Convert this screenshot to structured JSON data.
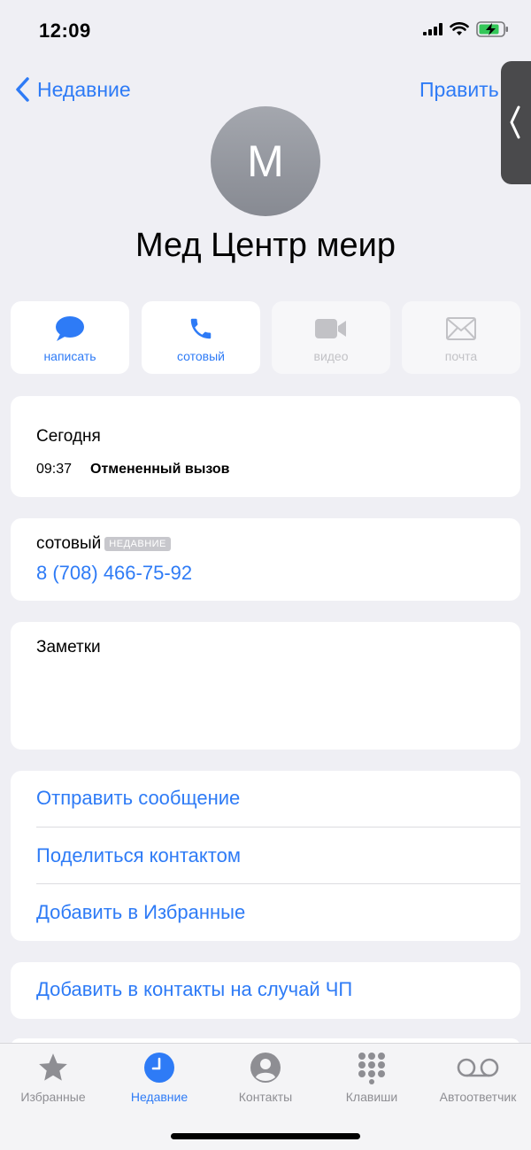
{
  "status_bar": {
    "time": "12:09"
  },
  "nav": {
    "back_label": "Недавние",
    "edit_label": "Править"
  },
  "contact": {
    "initial": "М",
    "name": "Мед Центр меир"
  },
  "actions": [
    {
      "label": "написать",
      "icon": "message-icon",
      "enabled": true
    },
    {
      "label": "сотовый",
      "icon": "phone-icon",
      "enabled": true
    },
    {
      "label": "видео",
      "icon": "video-icon",
      "enabled": false
    },
    {
      "label": "почта",
      "icon": "mail-icon",
      "enabled": false
    }
  ],
  "recent": {
    "day": "Сегодня",
    "time": "09:37",
    "call_type": "Отмененный вызов"
  },
  "phone": {
    "label": "сотовый",
    "badge": "НЕДАВНИЕ",
    "number": "8 (708) 466-75-92"
  },
  "notes": {
    "label": "Заметки"
  },
  "links": {
    "send_message": "Отправить сообщение",
    "share_contact": "Поделиться контактом",
    "add_favorites": "Добавить в Избранные",
    "emergency": "Добавить в контакты на случай ЧП"
  },
  "tabs": [
    {
      "label": "Избранные",
      "icon": "star-icon",
      "active": false
    },
    {
      "label": "Недавние",
      "icon": "clock-icon",
      "active": true
    },
    {
      "label": "Контакты",
      "icon": "person-icon",
      "active": false
    },
    {
      "label": "Клавиши",
      "icon": "keypad-icon",
      "active": false
    },
    {
      "label": "Автоответчик",
      "icon": "voicemail-icon",
      "active": false
    }
  ],
  "colors": {
    "accent": "#2e7bf6",
    "background": "#efeff4",
    "inactive": "#8e8e93"
  }
}
